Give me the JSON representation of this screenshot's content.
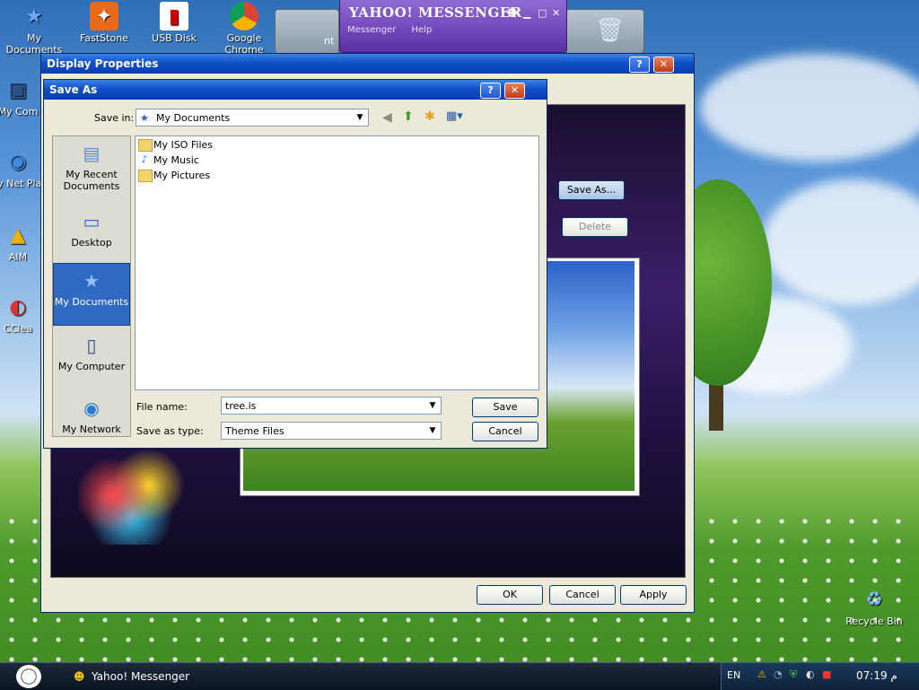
{
  "desktop": {
    "icons": [
      {
        "label": "My Documents",
        "icon": "star-documents-icon"
      },
      {
        "label": "FastStone",
        "icon": "faststone-icon"
      },
      {
        "label": "USB Disk",
        "icon": "usb-disk-icon"
      },
      {
        "label": "Google Chrome",
        "icon": "chrome-icon"
      },
      {
        "label": "My Com",
        "icon": "computer-icon"
      },
      {
        "label": "My Net Plac",
        "icon": "network-icon"
      },
      {
        "label": "AIM",
        "icon": "aim-icon"
      },
      {
        "label": "CClea",
        "icon": "ccleaner-icon"
      },
      {
        "label": "Recycle Bin",
        "icon": "recycle-bin-icon"
      }
    ],
    "bg_tile_label": "nt"
  },
  "yahoo": {
    "title": "YAHOO! MESSENGER",
    "menu": [
      "Messenger",
      "Help"
    ]
  },
  "display_properties": {
    "title": "Display Properties",
    "save_as_button": "Save As...",
    "delete_button": "Delete",
    "ok": "OK",
    "cancel": "Cancel",
    "apply": "Apply"
  },
  "save_as": {
    "title": "Save As",
    "save_in_label": "Save in:",
    "save_in_value": "My Documents",
    "places": [
      "My Recent Documents",
      "Desktop",
      "My Documents",
      "My Computer",
      "My Network"
    ],
    "files": [
      {
        "name": "My ISO Files",
        "icon": "folder-icon"
      },
      {
        "name": "My Music",
        "icon": "music-folder-icon"
      },
      {
        "name": "My Pictures",
        "icon": "pictures-folder-icon"
      }
    ],
    "file_name_label": "File name:",
    "file_name_value": "tree.is",
    "save_type_label": "Save as type:",
    "save_type_value": "Theme Files",
    "save_button": "Save",
    "cancel_button": "Cancel"
  },
  "taskbar": {
    "task": "Yahoo! Messenger",
    "lang": "EN",
    "time": "07:19",
    "ampm": "م"
  }
}
